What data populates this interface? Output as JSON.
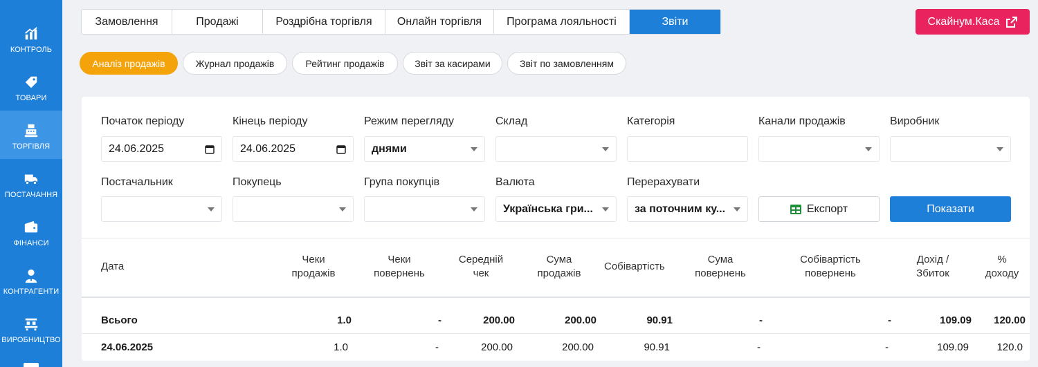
{
  "sidebar": {
    "items": [
      {
        "label": "Контроль",
        "icon": "chart-icon"
      },
      {
        "label": "Товари",
        "icon": "tag-icon"
      },
      {
        "label": "Торгівля",
        "icon": "cash-register-icon",
        "active": true
      },
      {
        "label": "Постачання",
        "icon": "truck-icon"
      },
      {
        "label": "Фінанси",
        "icon": "wallet-icon"
      },
      {
        "label": "Контрагенти",
        "icon": "person-icon"
      },
      {
        "label": "Виробництво",
        "icon": "factory-icon"
      }
    ]
  },
  "tabs": [
    "Замовлення",
    "Продажі",
    "Роздрібна торгівля",
    "Онлайн торгівля",
    "Програма лояльності",
    "Звіти"
  ],
  "active_tab": "Звіти",
  "kasa_button": "Скайнум.Каса",
  "subtabs": [
    "Аналіз продажів",
    "Журнал продажів",
    "Рейтинг продажів",
    "Звіт за касирами",
    "Звіт по замовленням"
  ],
  "active_subtab": "Аналіз продажів",
  "filters": {
    "period_start": {
      "label": "Початок періоду",
      "value": "24.06.2025"
    },
    "period_end": {
      "label": "Кінець періоду",
      "value": "24.06.2025"
    },
    "view_mode": {
      "label": "Режим перегляду",
      "value": "днями"
    },
    "warehouse": {
      "label": "Склад",
      "value": ""
    },
    "category": {
      "label": "Категорія",
      "value": ""
    },
    "channels": {
      "label": "Канали продажів",
      "value": ""
    },
    "manufacturer": {
      "label": "Виробник",
      "value": ""
    },
    "supplier": {
      "label": "Постачальник",
      "value": ""
    },
    "buyer": {
      "label": "Покупець",
      "value": ""
    },
    "buyer_group": {
      "label": "Група покупців",
      "value": ""
    },
    "currency": {
      "label": "Валюта",
      "value": "Українська гри..."
    },
    "recalc": {
      "label": "Перерахувати",
      "value": "за поточним ку..."
    }
  },
  "export_button": "Експорт",
  "show_button": "Показати",
  "table": {
    "headers": [
      [
        "Дата"
      ],
      [
        "Чеки",
        "продажів"
      ],
      [
        "Чеки",
        "повернень"
      ],
      [
        "Середній",
        "чек"
      ],
      [
        "Сума",
        "продажів"
      ],
      [
        "Собівартість"
      ],
      [
        "Сума",
        "повернень"
      ],
      [
        "Собівартість",
        "повернень"
      ],
      [
        "Дохід /",
        "Збиток"
      ],
      [
        "%",
        "доходу"
      ]
    ],
    "total": [
      "Всього",
      "1.0",
      "-",
      "200.00",
      "200.00",
      "90.91",
      "-",
      "-",
      "109.09",
      "120.00"
    ],
    "rows": [
      [
        "24.06.2025",
        "1.0",
        "-",
        "200.00",
        "200.00",
        "90.91",
        "-",
        "-",
        "109.09",
        "120.0"
      ]
    ]
  },
  "colors": {
    "sidebar": "#1e7fd9",
    "accent_blue": "#1e7fd9",
    "pink": "#e8235e",
    "orange": "#f5a30a"
  }
}
